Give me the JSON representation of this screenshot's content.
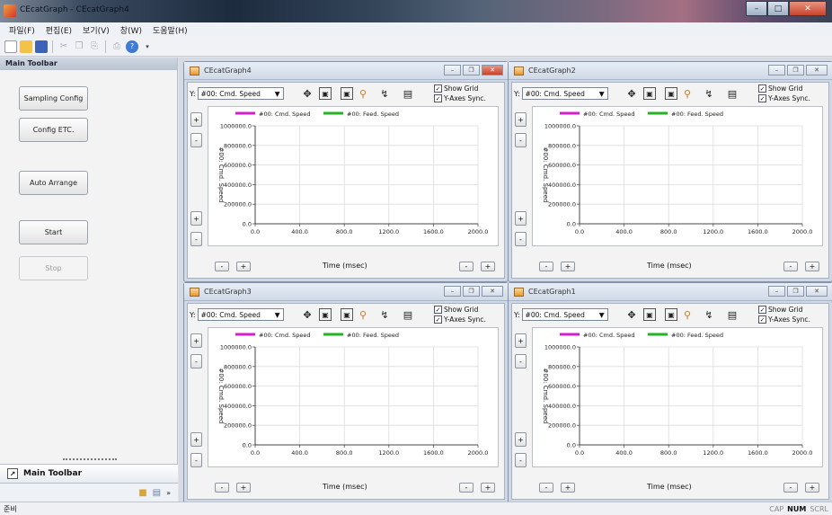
{
  "window": {
    "title": "CEcatGraph - CEcatGraph4"
  },
  "menu": [
    "파일(F)",
    "편집(E)",
    "보기(V)",
    "창(W)",
    "도움말(H)"
  ],
  "sidebar": {
    "title": "Main Toolbar",
    "buttons": {
      "sampling": "Sampling Config",
      "config_etc": "Config ETC.",
      "auto_arrange": "Auto Arrange",
      "start": "Start",
      "stop": "Stop"
    },
    "tab_label": "Main Toolbar"
  },
  "graphs": [
    {
      "title": "CEcatGraph4",
      "active": true
    },
    {
      "title": "CEcatGraph2",
      "active": false
    },
    {
      "title": "CEcatGraph3",
      "active": false
    },
    {
      "title": "CEcatGraph1",
      "active": false
    }
  ],
  "graph_common": {
    "y_prefix": "Y:",
    "selected_channel": "#00: Cmd. Speed",
    "show_grid": "Show Grid",
    "y_axes_sync": "Y-Axes Sync.",
    "legend": [
      "#00: Cmd. Speed",
      "#00: Feed. Speed"
    ],
    "legend_colors": [
      "#d61ed1",
      "#22b422"
    ],
    "x_label": "Time (msec)",
    "y_label": "#00: Cmd. Speed",
    "x_ticks": [
      "0.0",
      "400.0",
      "800.0",
      "1200.0",
      "1600.0",
      "2000.0"
    ],
    "y_ticks": [
      "1000000.0",
      "800000.0",
      "600000.0",
      "400000.0",
      "200000.0",
      "0.0"
    ],
    "plus": "+",
    "minus": "-"
  },
  "chart_data": {
    "type": "line",
    "xlabel": "Time (msec)",
    "ylabel": "#00: Cmd. Speed",
    "xlim": [
      0,
      2000
    ],
    "ylim": [
      0,
      1000000
    ],
    "grid": true,
    "legend_position": "top",
    "series": [
      {
        "name": "#00: Cmd. Speed",
        "color": "#d61ed1",
        "values": []
      },
      {
        "name": "#00: Feed. Speed",
        "color": "#22b422",
        "values": []
      }
    ]
  },
  "status": {
    "left": "준비",
    "cap": "CAP",
    "num": "NUM",
    "scrl": "SCRL"
  }
}
